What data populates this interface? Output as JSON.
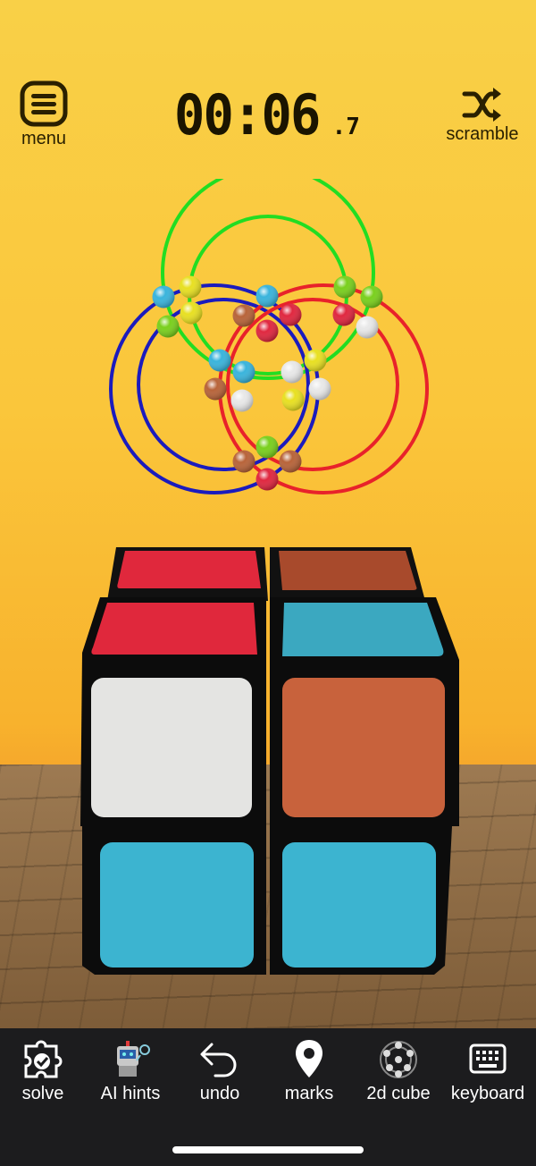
{
  "header": {
    "menu_label": "menu",
    "scramble_label": "scramble",
    "timer_main": "00:06",
    "timer_tenths": ".7"
  },
  "puzzle_graph": {
    "ring_colors": [
      "#22dd22",
      "#1b1bbd",
      "#e8222a"
    ],
    "ball_colors": {
      "cyan": "#3ab4dc",
      "yellow": "#e8e022",
      "green": "#7ad01e",
      "white": "#e8e8e8",
      "brown": "#b8643a",
      "red": "#e02840"
    }
  },
  "cube": {
    "top_back_left": "#e0283c",
    "top_back_right": "#a84a2c",
    "top_front_left": "#e0283c",
    "top_front_right": "#3ba8c0",
    "front_top_left": "#e4e4e2",
    "front_top_right": "#c8623c",
    "front_bottom_left": "#3cb4d0",
    "front_bottom_right": "#3cb4d0"
  },
  "toolbar": {
    "items": [
      {
        "label": "solve"
      },
      {
        "label": "AI hints"
      },
      {
        "label": "undo"
      },
      {
        "label": "marks"
      },
      {
        "label": "2d cube"
      },
      {
        "label": "keyboard"
      }
    ]
  }
}
